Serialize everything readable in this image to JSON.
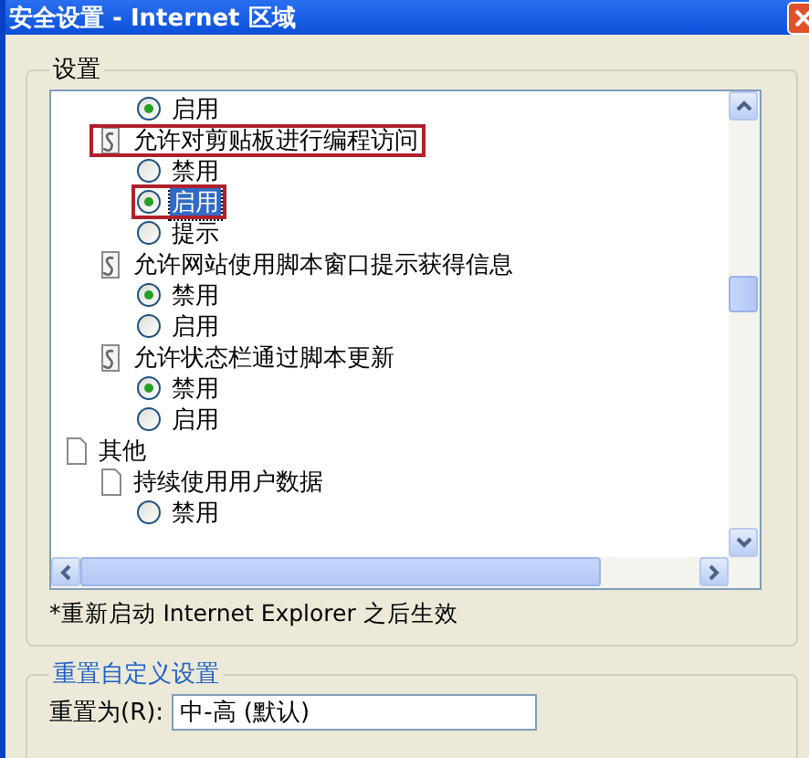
{
  "window": {
    "title": "安全设置 - Internet 区域"
  },
  "settings_group": {
    "title": "设置",
    "items": [
      {
        "kind": "option",
        "label": "启用",
        "selected": true,
        "focused": false,
        "highlighted": false
      },
      {
        "kind": "script-setting",
        "label": "允许对剪贴板进行编程访问",
        "highlighted": true,
        "children": [
          {
            "kind": "option",
            "label": "禁用",
            "selected": false,
            "focused": false,
            "highlighted": false
          },
          {
            "kind": "option",
            "label": "启用",
            "selected": true,
            "focused": true,
            "highlighted": true
          },
          {
            "kind": "option",
            "label": "提示",
            "selected": false,
            "focused": false,
            "highlighted": false
          }
        ]
      },
      {
        "kind": "script-setting",
        "label": "允许网站使用脚本窗口提示获得信息",
        "highlighted": false,
        "children": [
          {
            "kind": "option",
            "label": "禁用",
            "selected": true,
            "focused": false,
            "highlighted": false
          },
          {
            "kind": "option",
            "label": "启用",
            "selected": false,
            "focused": false,
            "highlighted": false
          }
        ]
      },
      {
        "kind": "script-setting",
        "label": "允许状态栏通过脚本更新",
        "highlighted": false,
        "children": [
          {
            "kind": "option",
            "label": "禁用",
            "selected": true,
            "focused": false,
            "highlighted": false
          },
          {
            "kind": "option",
            "label": "启用",
            "selected": false,
            "focused": false,
            "highlighted": false
          }
        ]
      },
      {
        "kind": "category",
        "label": "其他",
        "children": [
          {
            "kind": "page-setting",
            "label": "持续使用用户数据",
            "highlighted": false,
            "children": [
              {
                "kind": "option",
                "label": "禁用",
                "selected": false,
                "focused": false,
                "highlighted": false
              }
            ]
          }
        ]
      }
    ],
    "note": "*重新启动 Internet Explorer 之后生效"
  },
  "reset_group": {
    "title": "重置自定义设置",
    "label": "重置为(R):",
    "value": "中-高 (默认)"
  }
}
